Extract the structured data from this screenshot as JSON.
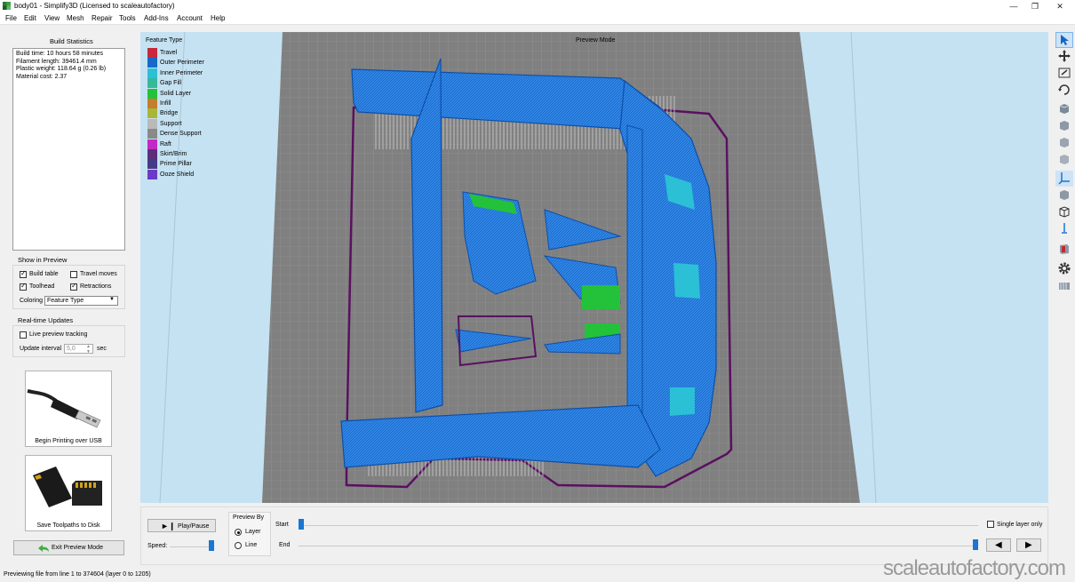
{
  "window": {
    "title": "body01 - Simplify3D (Licensed to scaleautofactory)"
  },
  "menu": [
    "File",
    "Edit",
    "View",
    "Mesh",
    "Repair",
    "Tools",
    "Add-Ins",
    "Account",
    "Help"
  ],
  "build_statistics": {
    "title": "Build Statistics",
    "lines": [
      "Build time: 10 hours 58 minutes",
      "Filament length: 39461.4 mm",
      "Plastic weight: 118.64 g (0.26 lb)",
      "Material cost: 2.37"
    ]
  },
  "show_in_preview": {
    "title": "Show in Preview",
    "build_table": "Build table",
    "travel_moves": "Travel moves",
    "toolhead": "Toolhead",
    "retractions": "Retractions",
    "coloring_label": "Coloring",
    "coloring_value": "Feature Type"
  },
  "realtime": {
    "title": "Real-time Updates",
    "live_tracking": "Live preview tracking",
    "interval_label": "Update interval",
    "interval_value": "5,0",
    "interval_unit": "sec"
  },
  "cards": {
    "usb": "Begin Printing over USB",
    "sd": "Save Toolpaths to Disk"
  },
  "exit_preview": "Exit Preview Mode",
  "viewport": {
    "mode_label": "Preview Mode",
    "legend_title": "Feature Type",
    "legend": [
      {
        "name": "Travel",
        "color": "#c8283a"
      },
      {
        "name": "Outer Perimeter",
        "color": "#1769c9"
      },
      {
        "name": "Inner Perimeter",
        "color": "#2bc0d6"
      },
      {
        "name": "Gap Fill",
        "color": "#36b89a"
      },
      {
        "name": "Solid Layer",
        "color": "#23c23a"
      },
      {
        "name": "Infill",
        "color": "#c47e2e"
      },
      {
        "name": "Bridge",
        "color": "#a8b63a"
      },
      {
        "name": "Support",
        "color": "#b9b9b9"
      },
      {
        "name": "Dense Support",
        "color": "#8a8a8a"
      },
      {
        "name": "Raft",
        "color": "#c228c6"
      },
      {
        "name": "Skirt/Brim",
        "color": "#5a2e7a"
      },
      {
        "name": "Prime Pillar",
        "color": "#463a86"
      },
      {
        "name": "Ooze Shield",
        "color": "#6a3ac6"
      }
    ]
  },
  "tools": [
    "select-arrow-icon",
    "move-icon",
    "zoom-icon",
    "rotate-icon",
    "view-default-icon",
    "view-front-icon",
    "view-back-icon",
    "view-left-icon",
    "axes-icon",
    "view-right-icon",
    "cube-wire-icon",
    "z-axis-icon",
    "section-icon",
    "settings-gear-icon",
    "bed-icon"
  ],
  "playback": {
    "play_pause": "Play/Pause",
    "speed_label": "Speed:",
    "speed": 1.0,
    "preview_by_title": "Preview By",
    "option_layer": "Layer",
    "option_line": "Line",
    "start_label": "Start",
    "end_label": "End",
    "start_value": 0,
    "end_value": 1205,
    "single_layer": "Single layer only"
  },
  "status": "Previewing file from line 1 to 374604 (layer 0 to 1205)",
  "watermark": "scaleautofactory.com"
}
